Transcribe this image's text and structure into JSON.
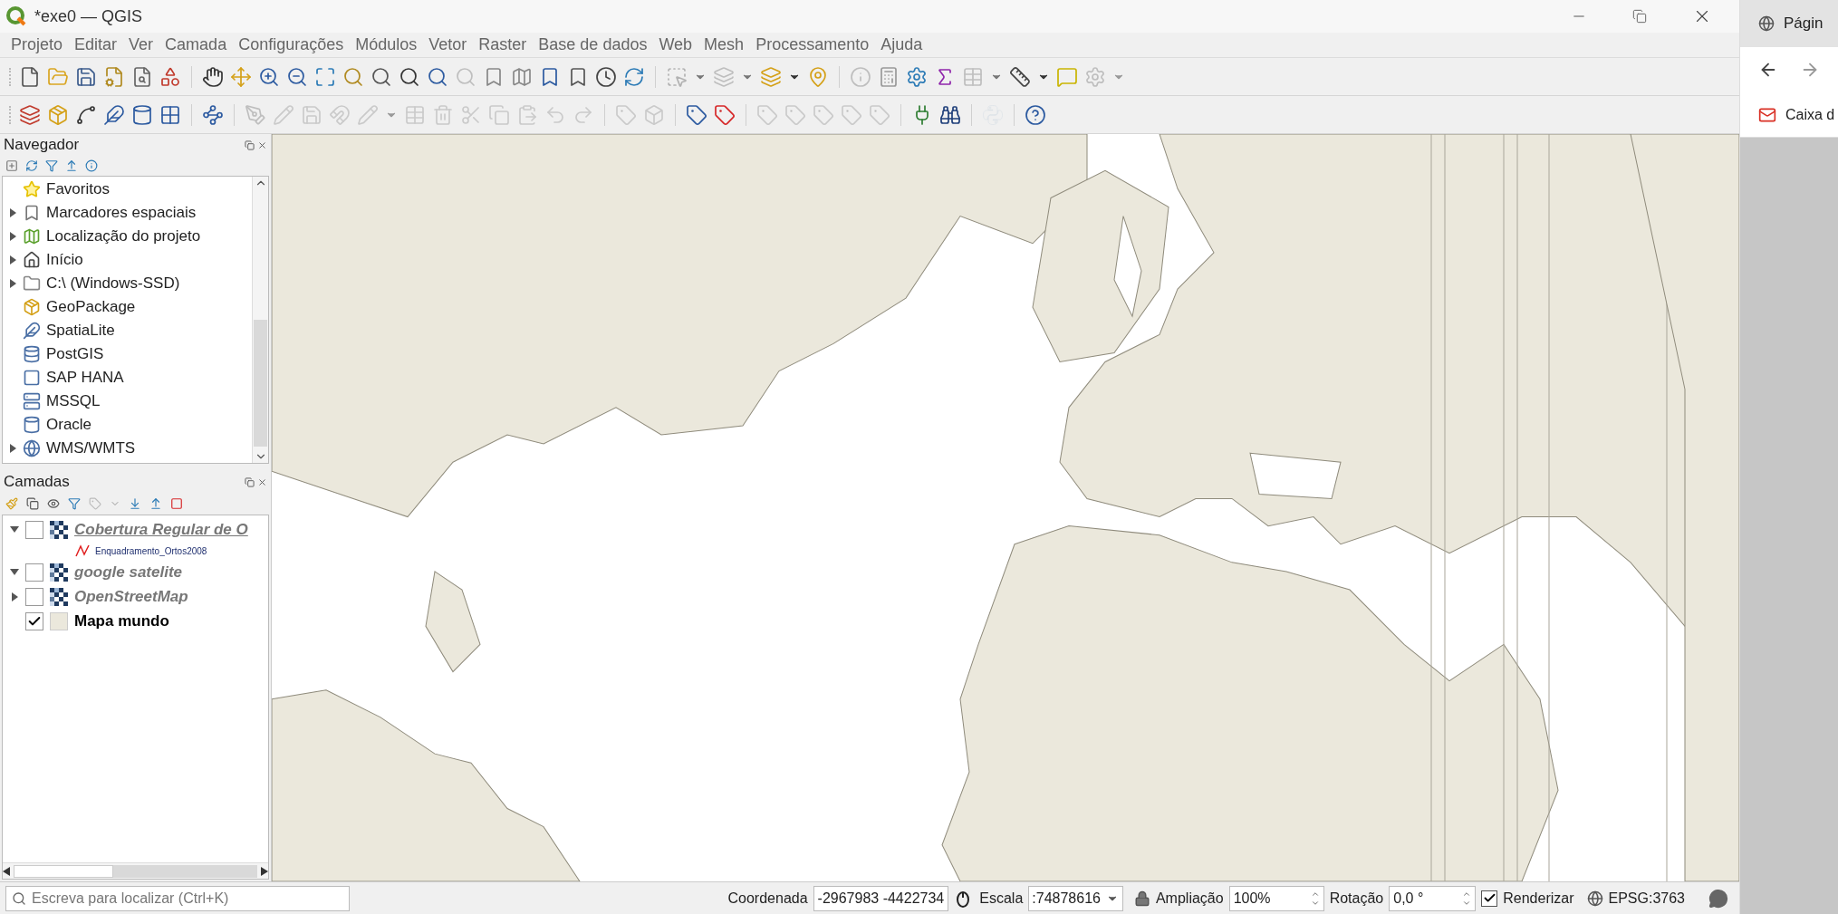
{
  "window": {
    "title": "*exe0 — QGIS"
  },
  "menu": [
    {
      "label": "Projeto"
    },
    {
      "label": "Editar"
    },
    {
      "label": "Ver"
    },
    {
      "label": "Camada"
    },
    {
      "label": "Configurações"
    },
    {
      "label": "Módulos"
    },
    {
      "label": "Vetor"
    },
    {
      "label": "Raster"
    },
    {
      "label": "Base de dados"
    },
    {
      "label": "Web"
    },
    {
      "label": "Mesh"
    },
    {
      "label": "Processamento"
    },
    {
      "label": "Ajuda"
    }
  ],
  "browser_panel": {
    "title": "Navegador",
    "items": [
      {
        "label": "Favoritos",
        "has_children": false
      },
      {
        "label": "Marcadores espaciais",
        "has_children": true
      },
      {
        "label": "Localização do projeto",
        "has_children": true
      },
      {
        "label": "Início",
        "has_children": true
      },
      {
        "label": "C:\\ (Windows-SSD)",
        "has_children": true
      },
      {
        "label": "GeoPackage",
        "has_children": false
      },
      {
        "label": "SpatiaLite",
        "has_children": false
      },
      {
        "label": "PostGIS",
        "has_children": false
      },
      {
        "label": "SAP HANA",
        "has_children": false
      },
      {
        "label": "MSSQL",
        "has_children": false
      },
      {
        "label": "Oracle",
        "has_children": false
      },
      {
        "label": "WMS/WMTS",
        "has_children": true
      }
    ]
  },
  "layers_panel": {
    "title": "Camadas",
    "layers": [
      {
        "name": "Cobertura Regular de O",
        "kind": "raster",
        "checked": false,
        "expanded": true,
        "selected": true,
        "children": [
          {
            "name": "Enquadramento_Ortos2008"
          }
        ]
      },
      {
        "name": "google satelite",
        "kind": "raster",
        "checked": false,
        "expanded": true,
        "selected": false
      },
      {
        "name": "OpenStreetMap",
        "kind": "raster",
        "checked": false,
        "expanded": false,
        "selected": false
      },
      {
        "name": "Mapa mundo",
        "kind": "vector",
        "checked": true,
        "selected": false
      }
    ]
  },
  "status_bar": {
    "search_placeholder": "Escreva para localizar (Ctrl+K)",
    "coordinate_label": "Coordenada",
    "coordinate": "-2967983 -4422734",
    "scale_label": "Escala",
    "scale": ":74878616",
    "magnifier_label": "Ampliação",
    "magnifier": "100%",
    "rotation_label": "Rotação",
    "rotation": "0,0 °",
    "render_label": "Renderizar",
    "render_checked": true,
    "crs": "EPSG:3763"
  },
  "side_browser": {
    "tab_title": "Págin",
    "bookmark": "Caixa d"
  }
}
